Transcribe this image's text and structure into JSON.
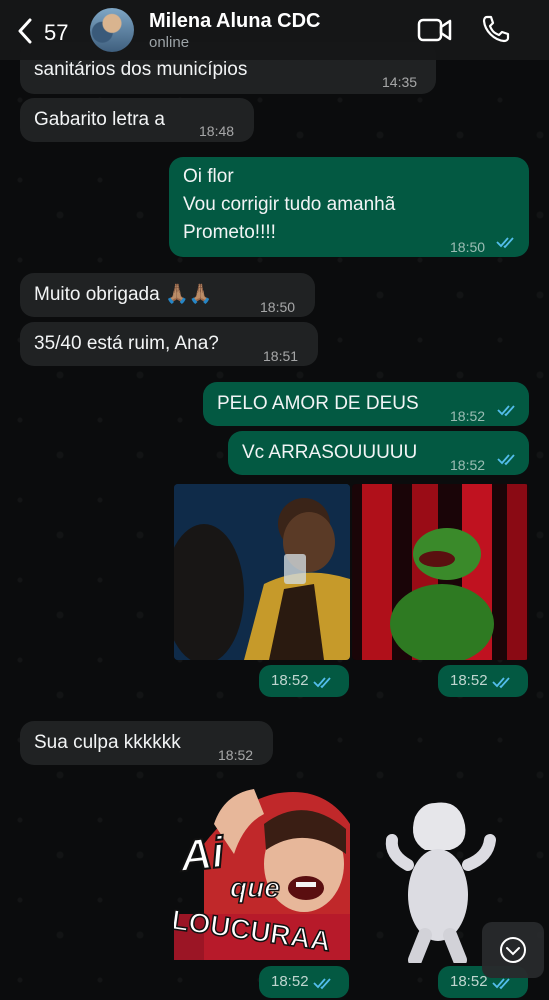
{
  "header": {
    "back_count": "57",
    "contact_name": "Milena Aluna CDC",
    "status": "online"
  },
  "messages": [
    {
      "dir": "in",
      "text": "sanitários dos municípios",
      "time": "14:35"
    },
    {
      "dir": "in",
      "text": "Gabarito letra a",
      "time": "18:48"
    },
    {
      "dir": "out",
      "text": "Oi flor\nVou corrigir tudo amanhã\nPrometo!!!!",
      "time": "18:50"
    },
    {
      "dir": "in",
      "text": "Muito obrigada 🙏🏽🙏🏽",
      "time": "18:50"
    },
    {
      "dir": "in",
      "text": "35/40 está ruim, Ana?",
      "time": "18:51"
    },
    {
      "dir": "out",
      "text": "PELO AMOR DE DEUS",
      "time": "18:52"
    },
    {
      "dir": "out",
      "text": "Vc ARRASOUUUUU",
      "time": "18:52"
    },
    {
      "dir": "out",
      "type": "gif",
      "description": "man toasting",
      "time": "18:52"
    },
    {
      "dir": "out",
      "type": "gif",
      "description": "green puppet dancing",
      "time": "18:52"
    },
    {
      "dir": "in",
      "text": "Sua culpa kkkkkk",
      "time": "18:52"
    },
    {
      "dir": "out",
      "type": "sticker",
      "time": "18:52",
      "overlay": [
        "Ai",
        "que",
        "LOUCURAA"
      ]
    },
    {
      "dir": "out",
      "type": "sticker",
      "description": "white ghost dancing",
      "time": "18:52"
    }
  ],
  "colors": {
    "incoming": "#202223",
    "outgoing": "#035942",
    "read_ticks": "#53bdeb"
  },
  "icons": [
    "chevron-left-icon",
    "video-call-icon",
    "phone-icon",
    "double-check-icon",
    "chevron-down-icon"
  ]
}
